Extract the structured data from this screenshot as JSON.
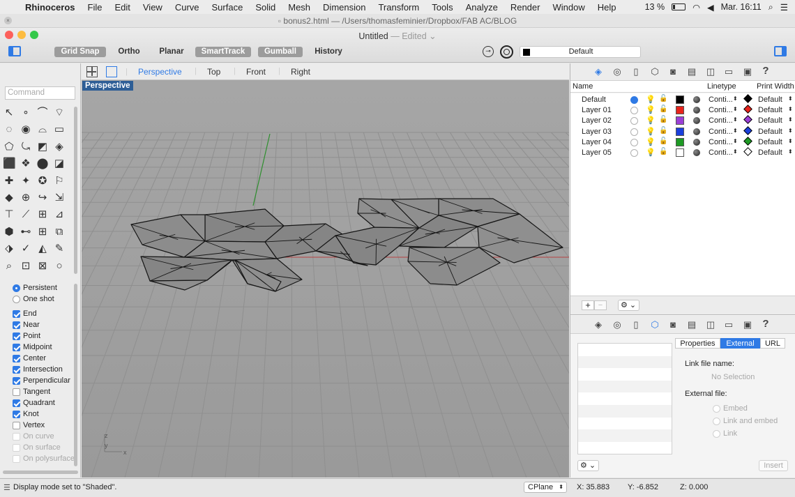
{
  "menubar": {
    "app": "Rhinoceros",
    "items": [
      "File",
      "Edit",
      "View",
      "Curve",
      "Surface",
      "Solid",
      "Mesh",
      "Dimension",
      "Transform",
      "Tools",
      "Analyze",
      "Render",
      "Window",
      "Help"
    ],
    "battery": "13 %",
    "clock": "Mar. 16:11"
  },
  "window": {
    "doc_path": "bonus2.html — /Users/thomasfeminier/Dropbox/FAB AC/BLOG",
    "title": "Untitled",
    "edited": "— Edited",
    "toggles": [
      {
        "label": "Grid Snap",
        "on": true
      },
      {
        "label": "Ortho",
        "on": false
      },
      {
        "label": "Planar",
        "on": false
      },
      {
        "label": "SmartTrack",
        "on": true
      },
      {
        "label": "Gumball",
        "on": true
      },
      {
        "label": "History",
        "on": false
      }
    ],
    "layer_select": "Default"
  },
  "command": {
    "placeholder": "Command"
  },
  "view_tabs": [
    "Perspective",
    "Top",
    "Front",
    "Right"
  ],
  "active_view": "Perspective",
  "viewport_label": "Perspective",
  "axis_labels": {
    "z": "z",
    "y": "y",
    "x": "x"
  },
  "osnaps": {
    "modes": [
      {
        "label": "Persistent",
        "on": true
      },
      {
        "label": "One shot",
        "on": false
      }
    ],
    "items": [
      {
        "label": "End",
        "on": true,
        "enabled": true
      },
      {
        "label": "Near",
        "on": true,
        "enabled": true
      },
      {
        "label": "Point",
        "on": true,
        "enabled": true
      },
      {
        "label": "Midpoint",
        "on": true,
        "enabled": true
      },
      {
        "label": "Center",
        "on": true,
        "enabled": true
      },
      {
        "label": "Intersection",
        "on": true,
        "enabled": true
      },
      {
        "label": "Perpendicular",
        "on": true,
        "enabled": true
      },
      {
        "label": "Tangent",
        "on": false,
        "enabled": true
      },
      {
        "label": "Quadrant",
        "on": true,
        "enabled": true
      },
      {
        "label": "Knot",
        "on": true,
        "enabled": true
      },
      {
        "label": "Vertex",
        "on": false,
        "enabled": true
      },
      {
        "label": "On curve",
        "on": false,
        "enabled": false
      },
      {
        "label": "On surface",
        "on": false,
        "enabled": false
      },
      {
        "label": "On polysurface",
        "on": false,
        "enabled": false
      }
    ]
  },
  "layers": {
    "headers": {
      "name": "Name",
      "linetype": "Linetype",
      "print_width": "Print Width"
    },
    "rows": [
      {
        "name": "Default",
        "current": true,
        "color": "#000000",
        "linetype": "Conti...",
        "print_color": "#000000",
        "print_width": "Default"
      },
      {
        "name": "Layer 01",
        "current": false,
        "color": "#e8241c",
        "linetype": "Conti...",
        "print_color": "#e8241c",
        "print_width": "Default"
      },
      {
        "name": "Layer 02",
        "current": false,
        "color": "#9b3fd6",
        "linetype": "Conti...",
        "print_color": "#9b3fd6",
        "print_width": "Default"
      },
      {
        "name": "Layer 03",
        "current": false,
        "color": "#1a3fdc",
        "linetype": "Conti...",
        "print_color": "#1a3fdc",
        "print_width": "Default"
      },
      {
        "name": "Layer 04",
        "current": false,
        "color": "#1e9a24",
        "linetype": "Conti...",
        "print_color": "#1e9a24",
        "print_width": "Default"
      },
      {
        "name": "Layer 05",
        "current": false,
        "color": "#ffffff",
        "linetype": "Conti...",
        "print_color": "#ffffff",
        "print_width": "Default"
      }
    ]
  },
  "properties": {
    "tabs": [
      "Properties",
      "External",
      "URL"
    ],
    "active_tab": "External",
    "link_file_label": "Link file name:",
    "no_selection": "No Selection",
    "external_file_label": "External file:",
    "options": [
      "Embed",
      "Link and embed",
      "Link"
    ],
    "insert": "Insert"
  },
  "status": {
    "message": "Display mode set to \"Shaded\".",
    "cplane": "CPlane",
    "x": "X: 35.883",
    "y": "Y: -6.852",
    "z": "Z: 0.000"
  },
  "colors": {
    "accent": "#2f7ae5",
    "viewport_bg": "#9c9c9c",
    "mesh_face": "#8a8a8a",
    "label_bg": "#2e5e96"
  }
}
